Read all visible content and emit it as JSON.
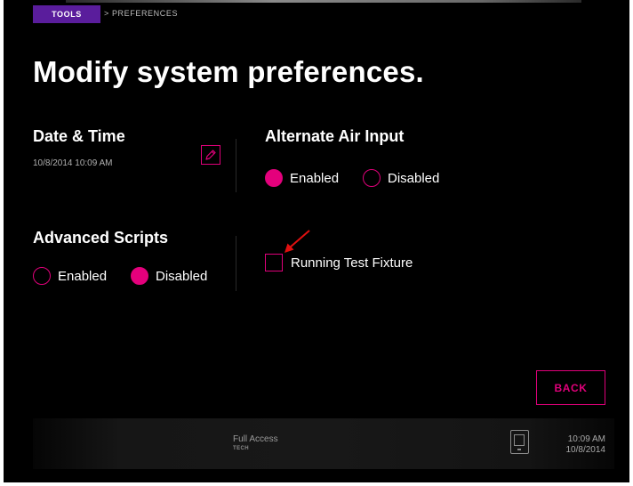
{
  "breadcrumb": {
    "tools": "TOOLS",
    "current": "> PREFERENCES"
  },
  "page_title": "Modify system preferences.",
  "date_time": {
    "title": "Date & Time",
    "value": "10/8/2014  10:09 AM"
  },
  "alternate_air": {
    "title": "Alternate Air Input",
    "options": [
      {
        "label": "Enabled",
        "selected": true
      },
      {
        "label": "Disabled",
        "selected": false
      }
    ]
  },
  "advanced_scripts": {
    "title": "Advanced Scripts",
    "options": [
      {
        "label": "Enabled",
        "selected": false
      },
      {
        "label": "Disabled",
        "selected": true
      }
    ]
  },
  "test_fixture": {
    "label": "Running Test Fixture",
    "checked": false
  },
  "back_label": "BACK",
  "footer": {
    "access": "Full Access",
    "role": "TECH",
    "time": "10:09 AM",
    "date": "10/8/2014"
  },
  "colors": {
    "accent": "#e4007c",
    "breadcrumb_bg": "#5a1d9c",
    "background": "#000000"
  },
  "icons": [
    "pencil-icon",
    "device-icon",
    "red-arrow-annotation"
  ]
}
